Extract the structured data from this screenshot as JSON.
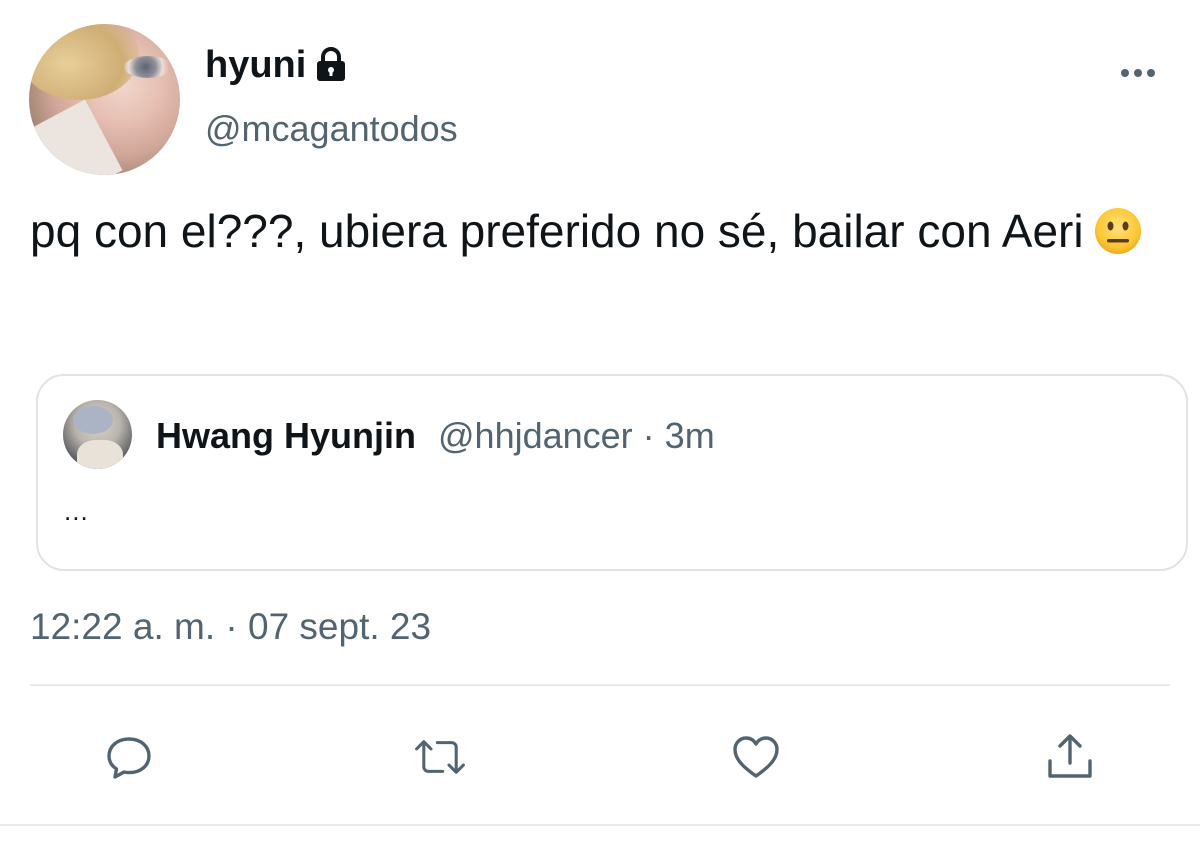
{
  "tweet": {
    "author": {
      "display_name": "hyuni",
      "handle": "@mcagantodos",
      "protected_icon": "lock-icon",
      "avatar": "user-avatar"
    },
    "text": "pq con el???, ubiera preferido no sé, bailar con Aeri",
    "emoji": "neutral-face-emoji",
    "timestamp": "12:22 a. m. · 07 sept. 23",
    "quoted_tweet": {
      "author_name": "Hwang Hyunjin",
      "author_handle": "@hhjdancer",
      "separator": "·",
      "time": "3m",
      "text": "...",
      "avatar": "quoted-user-avatar"
    },
    "actions": [
      {
        "icon": "reply-icon"
      },
      {
        "icon": "retweet-icon"
      },
      {
        "icon": "like-icon"
      },
      {
        "icon": "share-icon"
      }
    ],
    "more_icon": "more-options-icon"
  },
  "colors": {
    "text_primary": "#0f1419",
    "text_secondary": "#536471",
    "border": "#dde3e7",
    "icon": "#536471"
  }
}
